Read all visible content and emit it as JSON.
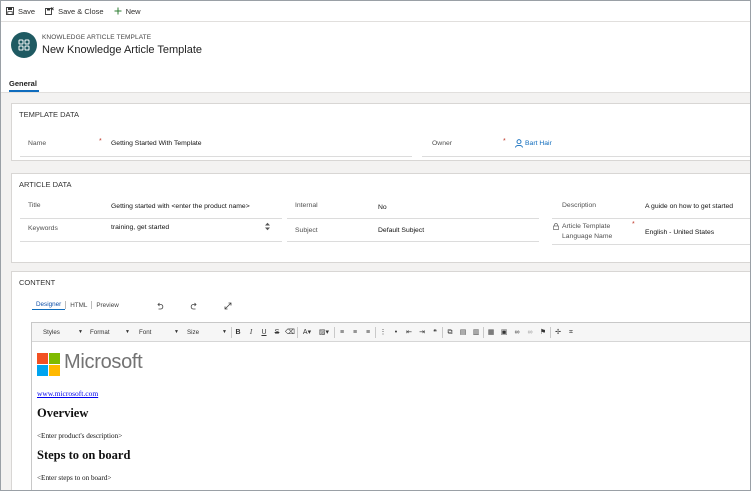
{
  "command_bar": {
    "save": "Save",
    "save_close": "Save & Close",
    "new": "New"
  },
  "header": {
    "entity": "KNOWLEDGE ARTICLE TEMPLATE",
    "title": "New Knowledge Article Template"
  },
  "tabs": {
    "general": "General"
  },
  "template_data": {
    "title": "TEMPLATE DATA",
    "name_label": "Name",
    "name_value": "Getting Started With Template",
    "owner_label": "Owner",
    "owner_value": "Bart Hair",
    "required_marker": "*"
  },
  "article_data": {
    "title": "ARTICLE DATA",
    "title_label": "Title",
    "title_value": "Getting started with <enter the product name>",
    "keywords_label": "Keywords",
    "keywords_value": "training, get started",
    "internal_label": "Internal",
    "internal_value": "No",
    "subject_label": "Subject",
    "subject_value": "Default Subject",
    "description_label": "Description",
    "description_value": "A guide on how to get started",
    "language_label_line1": "Article Template",
    "language_label_line2": "Language Name",
    "language_value": "English - United States"
  },
  "content": {
    "title": "CONTENT",
    "editor_tabs": [
      "Designer",
      "HTML",
      "Preview"
    ],
    "toolbar": {
      "styles": "Styles",
      "format": "Format",
      "font": "Font",
      "size": "Size"
    },
    "doc": {
      "logo_text": "Microsoft",
      "link": "www.microsoft.com",
      "heading1": "Overview",
      "para1": "<Enter product's description>",
      "heading2": "Steps to on board",
      "para2": "<Enter steps to on board>"
    }
  },
  "colors": {
    "accent": "#0f6cbd",
    "avatar": "#1f5a62",
    "required": "#c0392b",
    "link": "#0f6cbd"
  }
}
